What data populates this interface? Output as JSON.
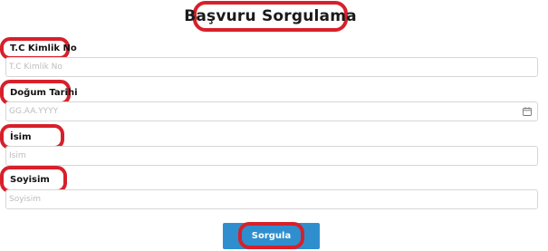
{
  "page": {
    "title": "Başvuru Sorgulama"
  },
  "form": {
    "tc": {
      "label": "T.C Kimlik No",
      "placeholder": "T.C Kimlik No",
      "value": ""
    },
    "birth": {
      "label": "Doğum Tarihi",
      "placeholder": "GG.AA.YYYY",
      "value": "",
      "icon": "calendar-icon"
    },
    "name": {
      "label": "İsim",
      "placeholder": "İsim",
      "value": ""
    },
    "surname": {
      "label": "Soyisim",
      "placeholder": "Soyisim",
      "value": ""
    }
  },
  "submit": {
    "label": "Sorgula"
  },
  "colors": {
    "highlight": "#d7202a",
    "button": "#2f8fce",
    "field_border": "#d6d6d6",
    "placeholder": "#bdbdbd"
  }
}
